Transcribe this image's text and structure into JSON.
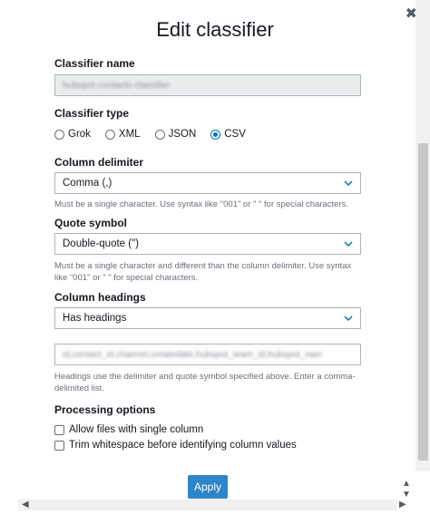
{
  "dialog": {
    "title": "Edit classifier",
    "close_glyph": "✖"
  },
  "classifier_name": {
    "label": "Classifier name",
    "value": "hubspot-contacts-classifier"
  },
  "classifier_type": {
    "label": "Classifier type",
    "options": [
      "Grok",
      "XML",
      "JSON",
      "CSV"
    ],
    "selected": "CSV"
  },
  "column_delimiter": {
    "label": "Column delimiter",
    "value": "Comma (,)",
    "help": "Must be a single character. Use syntax like \"001\" or \" \" for special characters."
  },
  "quote_symbol": {
    "label": "Quote symbol",
    "value": "Double-quote (\")",
    "help": "Must be a single character and different than the column delimiter. Use syntax like \"001\" or \" \" for special characters."
  },
  "column_headings": {
    "label": "Column headings",
    "value": "Has headings",
    "headings_value": "id,contact_id,channel,createdate,hubspot_team_id,hubspot_own",
    "help": "Headings use the delimiter and quote symbol specified above. Enter a comma-delimited list."
  },
  "processing_options": {
    "label": "Processing options",
    "allow_single_column": "Allow files with single column",
    "trim_whitespace": "Trim whitespace before identifying column values"
  },
  "footer": {
    "apply_label": "Apply"
  },
  "scrollbars": {
    "up": "▲",
    "down": "▼",
    "left": "◀",
    "right": "▶"
  },
  "colors": {
    "accent": "#0073bb",
    "apply_button": "#2e84c8"
  }
}
